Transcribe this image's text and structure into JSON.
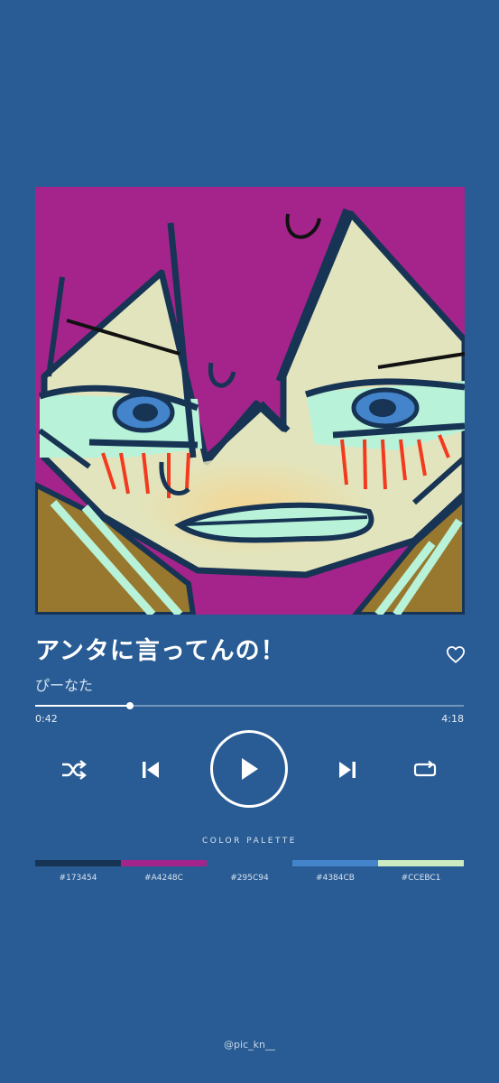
{
  "track": {
    "title": "アンタに言ってんの！",
    "artist": "ぴーなた"
  },
  "playback": {
    "elapsed": "0:42",
    "total": "4:18",
    "progress_fraction": 0.22
  },
  "controls": {
    "shuffle_icon": "shuffle-icon",
    "previous_icon": "skip-previous-icon",
    "play_icon": "play-icon",
    "next_icon": "skip-next-icon",
    "repeat_icon": "repeat-icon",
    "like_icon": "heart-outline-icon"
  },
  "palette": {
    "label": "COLOR PALETTE",
    "swatches": [
      {
        "hex": "#173454",
        "label": "#173454"
      },
      {
        "hex": "#A4248C",
        "label": "#A4248C"
      },
      {
        "hex": "#295C94",
        "label": "#295C94"
      },
      {
        "hex": "#4384CB",
        "label": "#4384CB"
      },
      {
        "hex": "#CCEBC1",
        "label": "#CCEBC1"
      }
    ]
  },
  "credit": "@pic_kn__",
  "colors": {
    "background": "#295C94",
    "accent": "#FFFFFF"
  }
}
